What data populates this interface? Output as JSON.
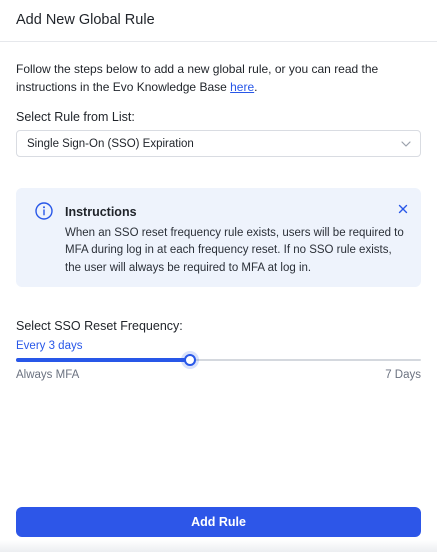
{
  "header": {
    "title": "Add New Global Rule"
  },
  "intro": {
    "text": "Follow the steps below to add a new global rule, or you can read the instructions in the Evo Knowledge Base ",
    "link_label": "here",
    "trailing": "."
  },
  "rule_select": {
    "label": "Select Rule from List:",
    "value": "Single Sign-On (SSO) Expiration",
    "icon": "chevron-down-icon"
  },
  "instructions": {
    "title": "Instructions",
    "body": "When an SSO reset frequency rule exists, users will be required to MFA during log in at each frequency reset. If no SSO rule exists, the user will always be required to MFA at log in.",
    "icon": "info-icon",
    "close_icon": "close-icon",
    "accent": "#2857e8",
    "background": "#eef3fc"
  },
  "frequency": {
    "label": "Select SSO Reset Frequency:",
    "current_value": "Every 3 days",
    "slider_fraction": 0.43,
    "min_label": "Always MFA",
    "max_label": "7 Days"
  },
  "submit": {
    "label": "Add Rule",
    "color": "#2d56e8"
  }
}
